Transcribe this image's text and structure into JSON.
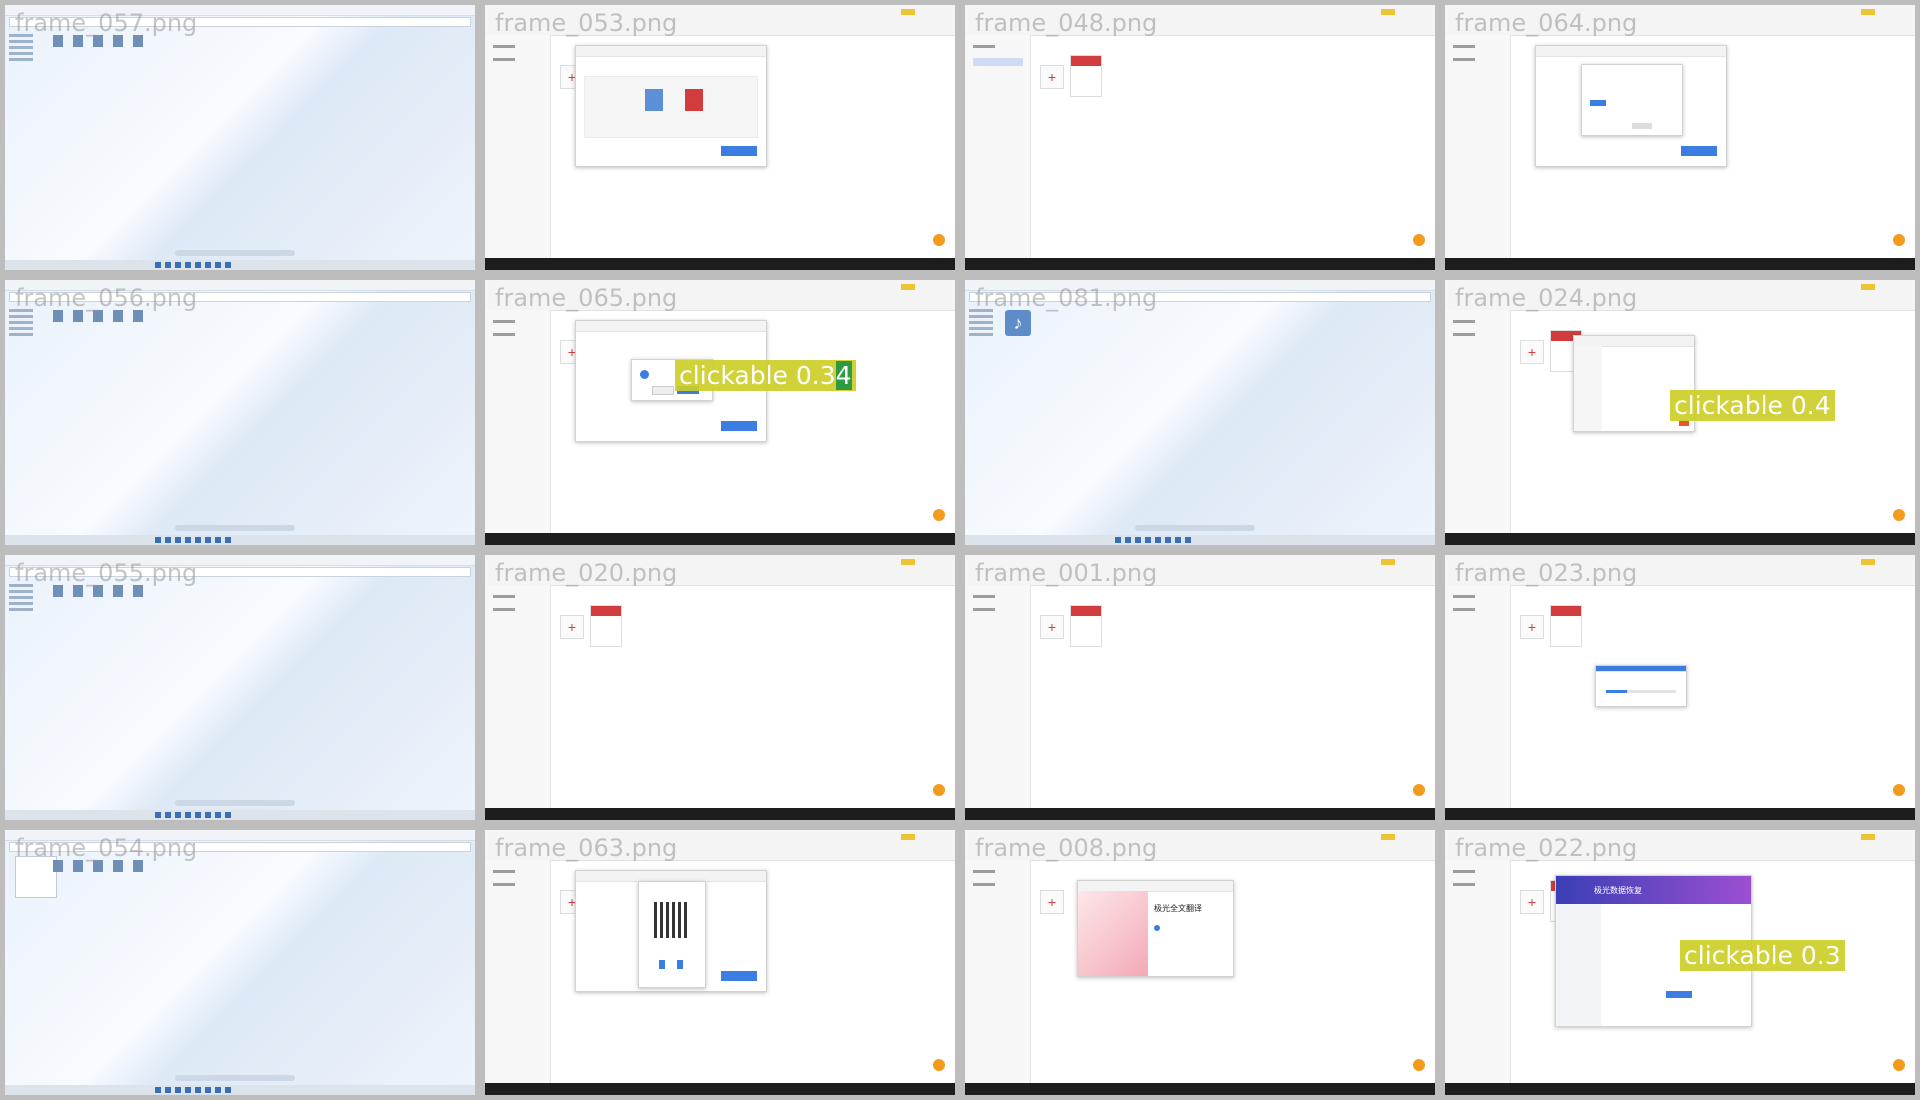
{
  "frames": [
    {
      "label": "frame_057.png",
      "kind": "explorer"
    },
    {
      "label": "frame_053.png",
      "kind": "pdf-convert"
    },
    {
      "label": "frame_048.png",
      "kind": "pdf-list"
    },
    {
      "label": "frame_064.png",
      "kind": "pdf-dialog"
    },
    {
      "label": "frame_056.png",
      "kind": "explorer"
    },
    {
      "label": "frame_065.png",
      "kind": "pdf-confirm"
    },
    {
      "label": "frame_081.png",
      "kind": "explorer-music"
    },
    {
      "label": "frame_024.png",
      "kind": "pdf-settings"
    },
    {
      "label": "frame_055.png",
      "kind": "explorer"
    },
    {
      "label": "frame_020.png",
      "kind": "pdf-list"
    },
    {
      "label": "frame_001.png",
      "kind": "pdf-list"
    },
    {
      "label": "frame_023.png",
      "kind": "pdf-progress"
    },
    {
      "label": "frame_054.png",
      "kind": "explorer-menu"
    },
    {
      "label": "frame_063.png",
      "kind": "pdf-qr"
    },
    {
      "label": "frame_008.png",
      "kind": "pdf-translate"
    },
    {
      "label": "frame_022.png",
      "kind": "pdf-promo"
    }
  ],
  "tags": {
    "t1": {
      "prefix": "clickable 0.3",
      "highlight": "4"
    },
    "t2": {
      "text": "clickable 0.4"
    },
    "t3": {
      "text": "clickable 0.3"
    }
  },
  "translate": {
    "title": "极光全文翻译"
  },
  "promo": {
    "title": "极光数据恢复"
  },
  "colors": {
    "accent": "#3b7de0",
    "brand_red": "#d33c3c",
    "fab": "#f39b1a",
    "tag": "#cdcd28",
    "tag_hl": "#2e9b3e"
  }
}
